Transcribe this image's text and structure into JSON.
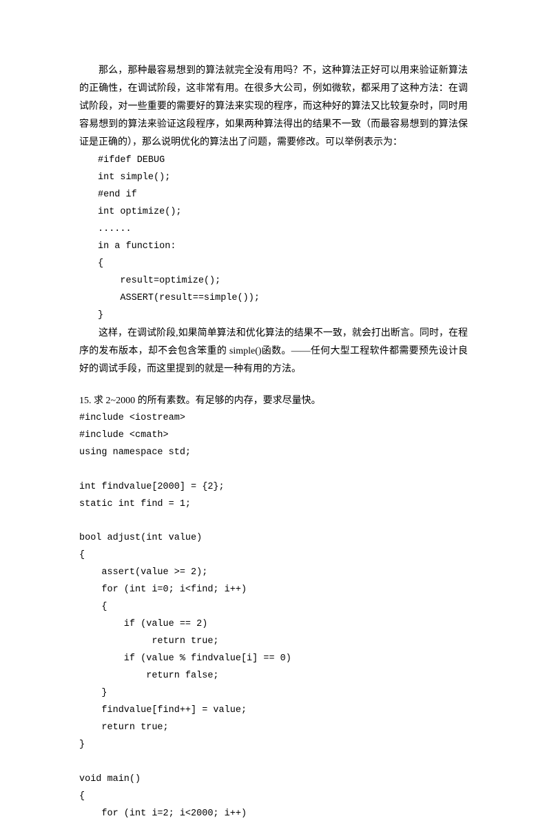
{
  "para1": "那么，那种最容易想到的算法就完全没有用吗？不，这种算法正好可以用来验证新算法的正确性，在调试阶段，这非常有用。在很多大公司，例如微软，都采用了这种方法：在调试阶段，对一些重要的需要好的算法来实现的程序，而这种好的算法又比较复杂时，同时用容易想到的算法来验证这段程序，如果两种算法得出的结果不一致（而最容易想到的算法保证是正确的），那么说明优化的算法出了问题，需要修改。可以举例表示为：",
  "code1": "#ifdef DEBUG\nint simple();\n#end if\nint optimize();\n......\nin a function:\n{\n    result=optimize();\n    ASSERT(result==simple());\n}",
  "para2": "这样，在调试阶段,如果简单算法和优化算法的结果不一致，就会打出断言。同时，在程序的发布版本，却不会包含笨重的 simple()函数。——任何大型工程软件都需要预先设计良好的调试手段，而这里提到的就是一种有用的方法。",
  "problem": "15. 求 2~2000 的所有素数。有足够的内存，要求尽量快。",
  "code2": "#include <iostream>\n#include <cmath>\nusing namespace std;\n\nint findvalue[2000] = {2};\nstatic int find = 1;\n\nbool adjust(int value)\n{\n    assert(value >= 2);\n    for (int i=0; i<find; i++)\n    {\n        if (value == 2)\n             return true;\n        if (value % findvalue[i] == 0)\n            return false;\n    }\n    findvalue[find++] = value;\n    return true;\n}\n\nvoid main()\n{\n    for (int i=2; i<2000; i++)"
}
